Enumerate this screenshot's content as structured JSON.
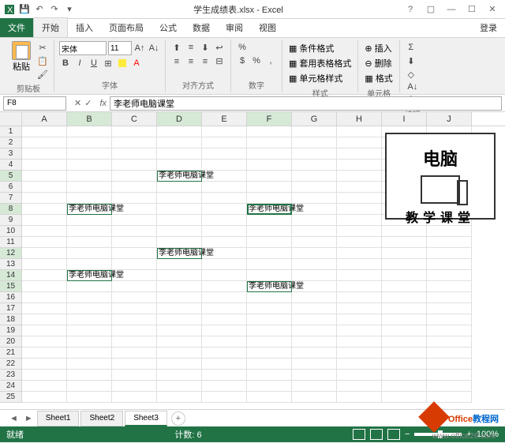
{
  "title": "学生成绩表.xlsx - Excel",
  "tabs": {
    "file": "文件",
    "home": "开始",
    "insert": "插入",
    "layout": "页面布局",
    "formula": "公式",
    "data": "数据",
    "review": "审阅",
    "view": "视图"
  },
  "login": "登录",
  "ribbon": {
    "paste": "粘贴",
    "clipboard": "剪贴板",
    "font_name": "宋体",
    "font_size": "11",
    "font_group": "字体",
    "align_group": "对齐方式",
    "number_group": "数字",
    "cond_fmt": "条件格式",
    "tbl_fmt": "套用表格格式",
    "cell_style": "单元格样式",
    "styles_group": "样式",
    "ins": "插入",
    "del": "删除",
    "fmt2": "格式",
    "cells_group": "单元格",
    "edit_group": "编辑"
  },
  "namebox": "F8",
  "formula": "李老师电脑课堂",
  "columns": [
    "A",
    "B",
    "C",
    "D",
    "E",
    "F",
    "G",
    "H",
    "I",
    "J"
  ],
  "rows": 25,
  "cells": {
    "D5": "李老师电脑课堂",
    "B8": "李老师电脑课堂",
    "F8": "李老师电脑课堂",
    "D12": "李老师电脑课堂",
    "B14": "李老师电脑课堂",
    "F15": "李老师电脑课堂"
  },
  "selected": [
    "D5",
    "B8",
    "F8",
    "D12",
    "B14",
    "F15"
  ],
  "active": "F8",
  "sheets": [
    "Sheet1",
    "Sheet2",
    "Sheet3"
  ],
  "active_sheet": "Sheet3",
  "status": {
    "ready": "就绪",
    "count_label": "计数:",
    "count": "6",
    "zoom": "100%"
  },
  "overlay1": {
    "line1": "电脑",
    "line2": "教学课堂"
  },
  "overlay2": {
    "brand": "Office",
    "suffix": "教程网",
    "url": "www.office26.com"
  }
}
